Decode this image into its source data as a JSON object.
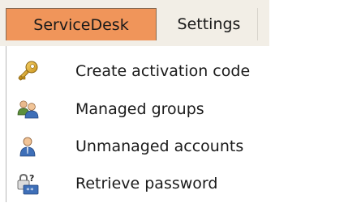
{
  "menubar": {
    "tabs": [
      {
        "label": "ServiceDesk",
        "active": true
      },
      {
        "label": "Settings",
        "active": false
      }
    ]
  },
  "dropdown": {
    "items": [
      {
        "label": "Create activation code",
        "icon": "key-icon"
      },
      {
        "label": "Managed groups",
        "icon": "users-group-icon"
      },
      {
        "label": "Unmanaged accounts",
        "icon": "user-icon"
      },
      {
        "label": "Retrieve password",
        "icon": "password-lock-icon"
      }
    ]
  },
  "colors": {
    "active_tab": "#f0955a",
    "menubar_bg": "#f2eee6"
  }
}
